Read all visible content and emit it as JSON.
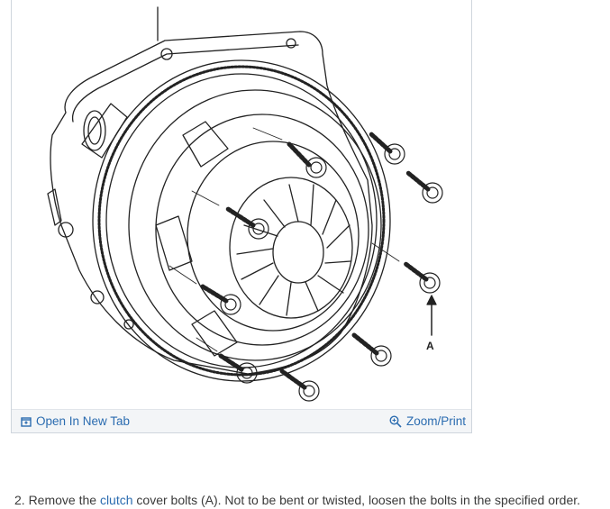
{
  "figure": {
    "callout_label": "A",
    "toolbar": {
      "open_tab_label": "Open In New Tab",
      "zoom_label": "Zoom/Print"
    }
  },
  "step": {
    "number_prefix": "2. Remove the ",
    "link_text": "clutch",
    "rest_text": " cover bolts (A). Not to be bent or twisted, loosen the bolts in the specified order."
  },
  "colors": {
    "link": "#2b6cb0",
    "text": "#3a3a3a",
    "toolbar_bg": "#f3f5f7",
    "border": "#cfd6dd"
  }
}
